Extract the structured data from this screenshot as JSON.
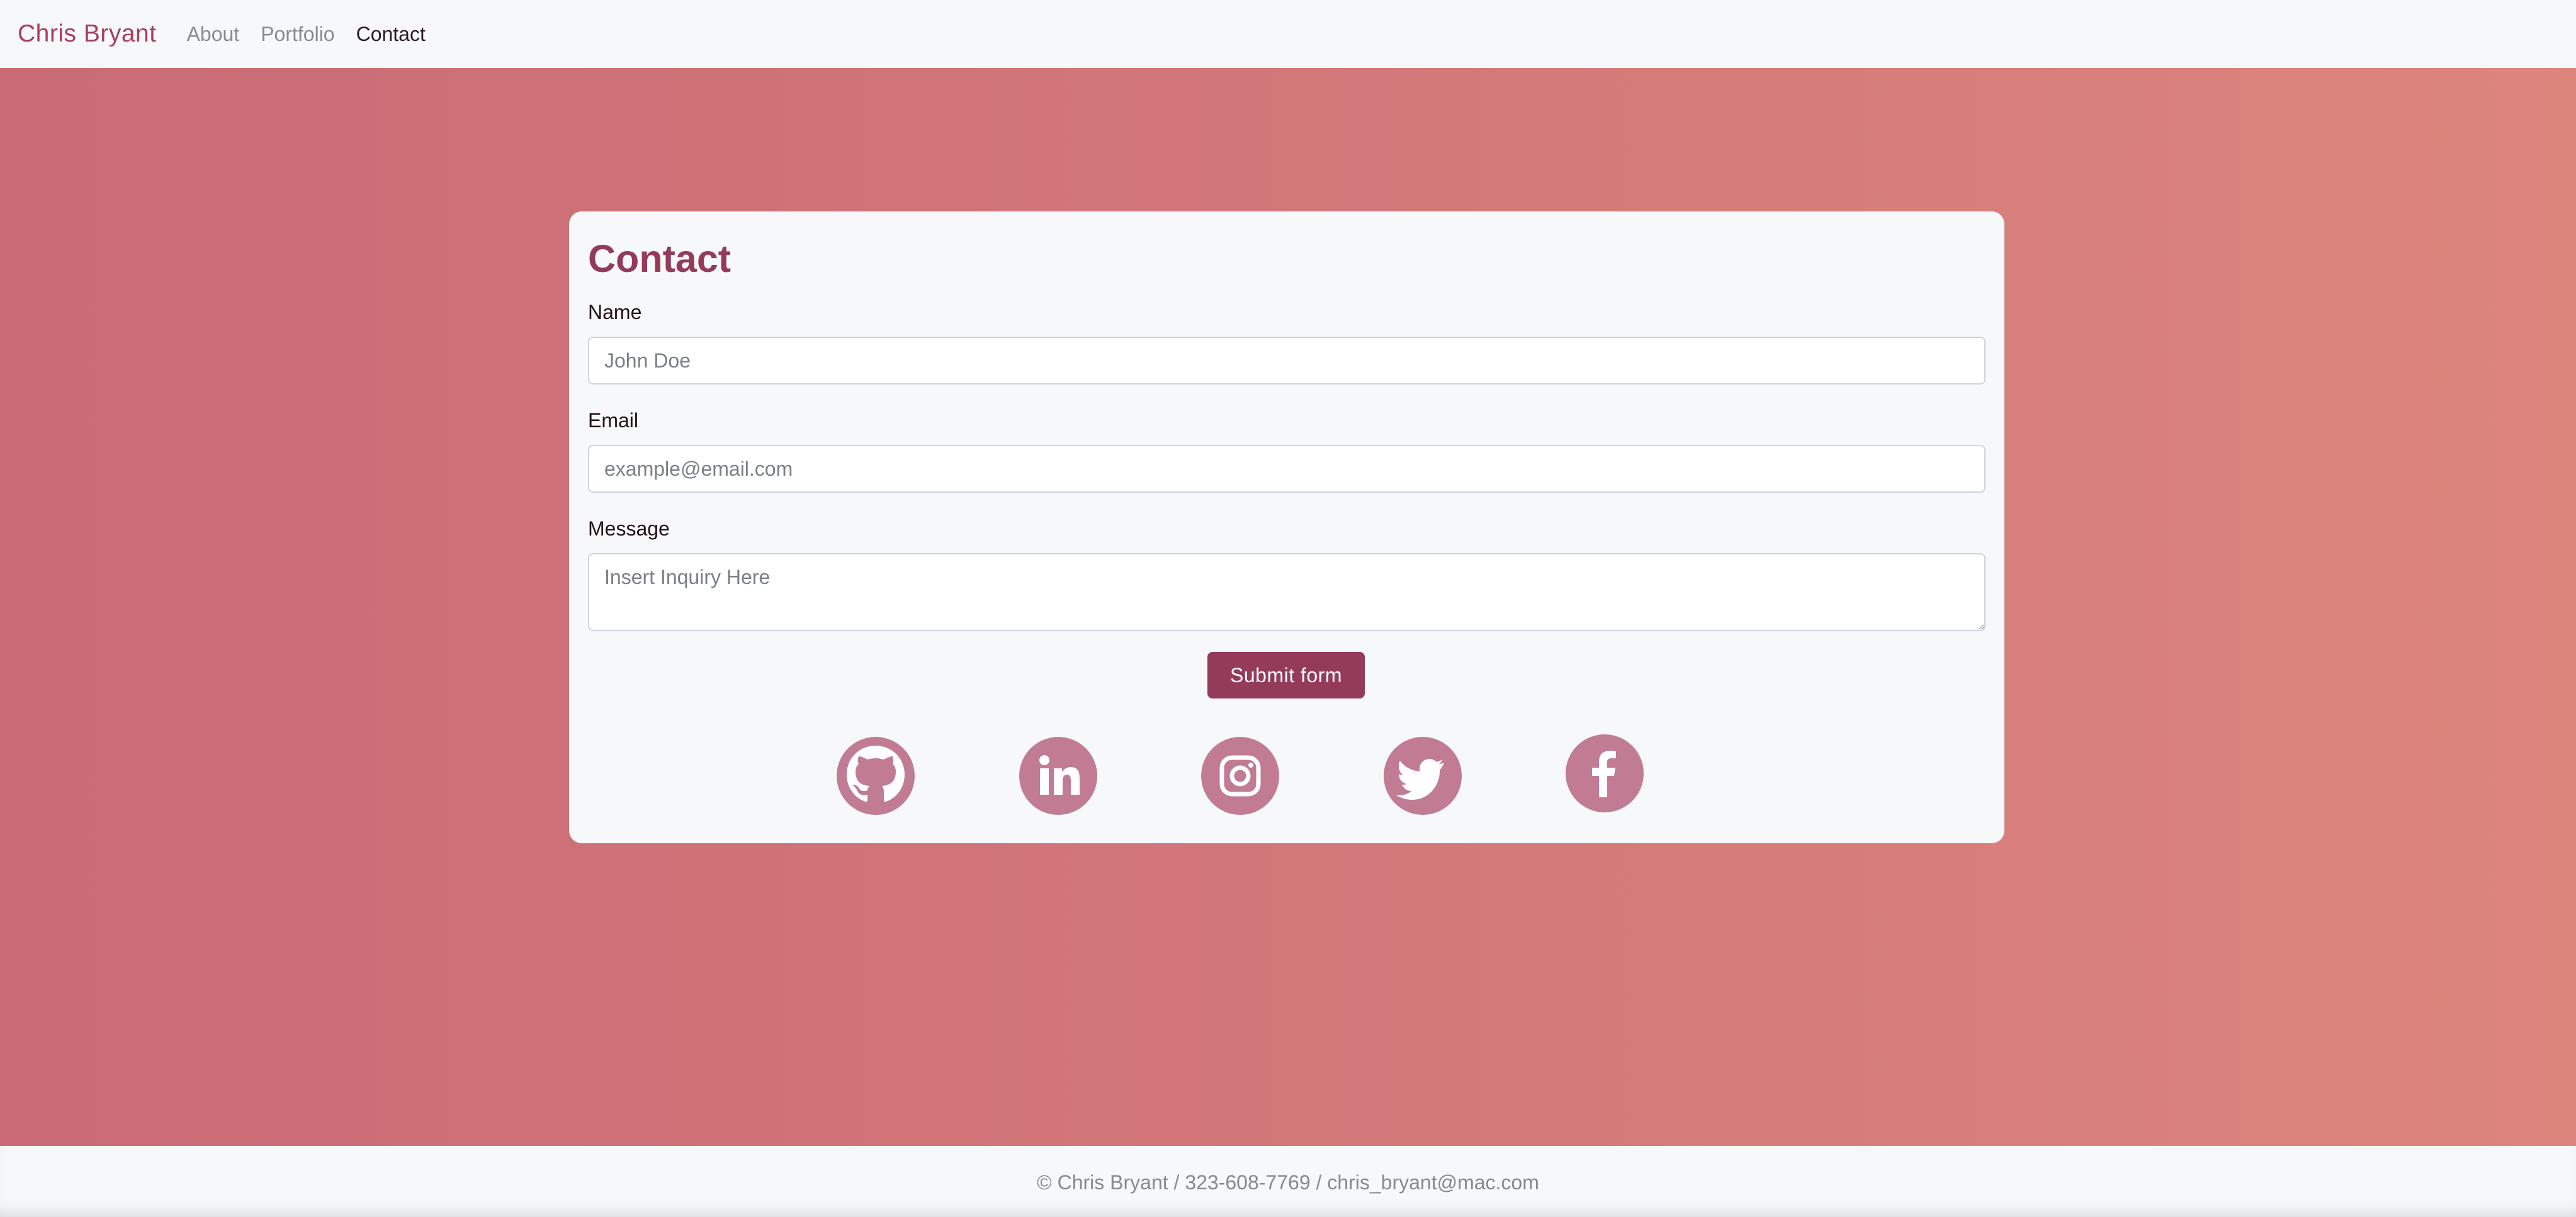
{
  "navbar": {
    "brand": "Chris Bryant",
    "links": [
      {
        "label": "About"
      },
      {
        "label": "Portfolio"
      },
      {
        "label": "Contact"
      }
    ]
  },
  "contact": {
    "title": "Contact",
    "name": {
      "label": "Name",
      "placeholder": "John Doe",
      "value": ""
    },
    "email": {
      "label": "Email",
      "placeholder": "example@email.com",
      "value": ""
    },
    "message": {
      "label": "Message",
      "placeholder": "Insert Inquiry Here",
      "value": ""
    },
    "submit_label": "Submit form",
    "social": [
      {
        "icon": "github-icon"
      },
      {
        "icon": "linkedin-icon"
      },
      {
        "icon": "instagram-icon"
      },
      {
        "icon": "twitter-icon"
      },
      {
        "icon": "facebook-icon"
      }
    ]
  },
  "footer": {
    "text": "© Chris Bryant / 323-608-7769 / chris_bryant@mac.com"
  },
  "colors": {
    "brand": "#a83f5c",
    "accent": "#943b59",
    "social": "#c17b93",
    "gradient_start": "#ca6b76",
    "gradient_end": "#dc857d"
  }
}
